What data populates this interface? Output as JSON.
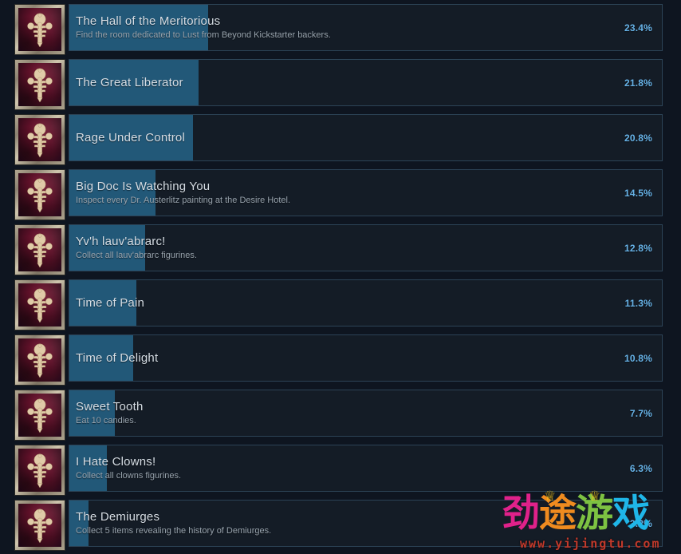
{
  "page": {
    "background_color": "#0e1520",
    "row_background_color": "#141c26",
    "row_border_color": "#2c4356",
    "progress_fill_color": "#225878",
    "percent_text_color": "#67b3e8",
    "title_text_color": "#d6dde4",
    "description_text_color": "#98a3ad"
  },
  "achievements": [
    {
      "name": "The Hall of the Meritorious",
      "description": "Find the room dedicated to Lust from Beyond Kickstarter backers.",
      "percent": "23.4%",
      "percent_value": 23.4,
      "icon": "maroon-ornate-emblem-icon"
    },
    {
      "name": "The Great Liberator",
      "description": "",
      "percent": "21.8%",
      "percent_value": 21.8,
      "icon": "maroon-ornate-emblem-icon"
    },
    {
      "name": "Rage Under Control",
      "description": "",
      "percent": "20.8%",
      "percent_value": 20.8,
      "icon": "maroon-ornate-emblem-icon"
    },
    {
      "name": "Big Doc Is Watching You",
      "description": "Inspect every Dr. Austerlitz painting at the Desire Hotel.",
      "percent": "14.5%",
      "percent_value": 14.5,
      "icon": "maroon-ornate-emblem-icon"
    },
    {
      "name": "Yv'h lauv'abrarc!",
      "description": "Collect all lauv'abrarc figurines.",
      "percent": "12.8%",
      "percent_value": 12.8,
      "icon": "maroon-ornate-emblem-icon"
    },
    {
      "name": "Time of Pain",
      "description": "",
      "percent": "11.3%",
      "percent_value": 11.3,
      "icon": "maroon-ornate-emblem-icon"
    },
    {
      "name": "Time of Delight",
      "description": "",
      "percent": "10.8%",
      "percent_value": 10.8,
      "icon": "maroon-ornate-emblem-icon"
    },
    {
      "name": "Sweet Tooth",
      "description": "Eat 10 candies.",
      "percent": "7.7%",
      "percent_value": 7.7,
      "icon": "maroon-ornate-emblem-icon"
    },
    {
      "name": "I Hate Clowns!",
      "description": "Collect all clowns figurines.",
      "percent": "6.3%",
      "percent_value": 6.3,
      "icon": "maroon-ornate-emblem-icon"
    },
    {
      "name": "The Demiurges",
      "description": "Collect 5 items revealing the history of Demiurges.",
      "percent": "3.2%",
      "percent_value": 3.2,
      "icon": "maroon-ornate-emblem-icon"
    }
  ],
  "watermark": {
    "char1": "劲",
    "char2": "途",
    "char3": "游",
    "char4": "戏",
    "url": "www.yijingtu.com"
  }
}
